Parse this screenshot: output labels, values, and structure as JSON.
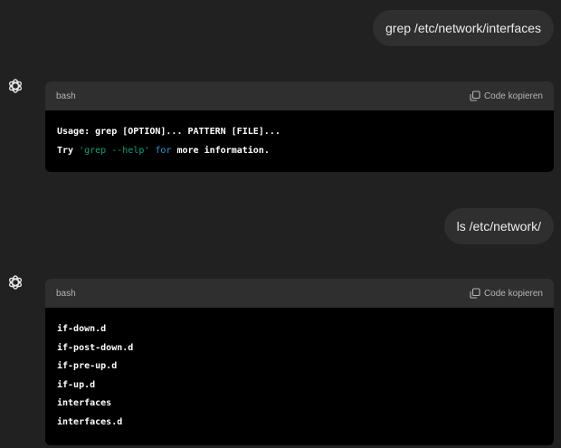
{
  "messages": [
    {
      "role": "user",
      "text": "grep /etc/network/interfaces"
    },
    {
      "role": "assistant",
      "code": {
        "language": "bash",
        "copy_label": "Code kopieren",
        "line1": "Usage: grep [OPTION]... PATTERN [FILE]...",
        "line2_prefix": "Try ",
        "line2_string": "'grep --help'",
        "line2_mid": " ",
        "line2_keyword": "for",
        "line2_suffix": " more information."
      }
    },
    {
      "role": "user",
      "text": "ls /etc/network/"
    },
    {
      "role": "assistant",
      "code": {
        "language": "bash",
        "copy_label": "Code kopieren",
        "lines": [
          "if-down.d",
          "if-post-down.d",
          "if-pre-up.d",
          "if-up.d",
          "interfaces",
          "interfaces.d"
        ]
      }
    }
  ],
  "icons": {
    "avatar": "openai-logo-icon",
    "copy": "copy-icon"
  },
  "colors": {
    "background": "#212121",
    "bubble": "#2f2f2f",
    "code_header": "#2f2f2f",
    "code_body": "#000000",
    "string": "#00a67d",
    "keyword": "#2e95d3"
  }
}
